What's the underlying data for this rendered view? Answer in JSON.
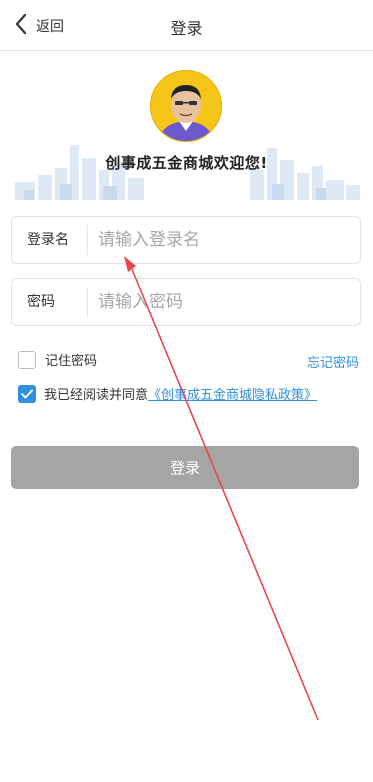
{
  "header": {
    "back_label": "返回",
    "title": "登录"
  },
  "hero": {
    "slogan": "创事成五金商城欢迎您!"
  },
  "login_form": {
    "username_label": "登录名",
    "username_placeholder": "请输入登录名",
    "password_label": "密码",
    "password_placeholder": "请输入密码"
  },
  "options": {
    "remember_label": "记住密码",
    "forgot_label": "忘记密码",
    "agree_text": "我已经阅读并同意",
    "policy_link": "《创事成五金商城隐私政策》"
  },
  "actions": {
    "login_label": "登录"
  },
  "colors": {
    "accent": "#2f8fe0",
    "button_disabled": "#a5a5a5",
    "avatar_bg": "#f5c518",
    "annotation_arrow": "#e8474c"
  }
}
